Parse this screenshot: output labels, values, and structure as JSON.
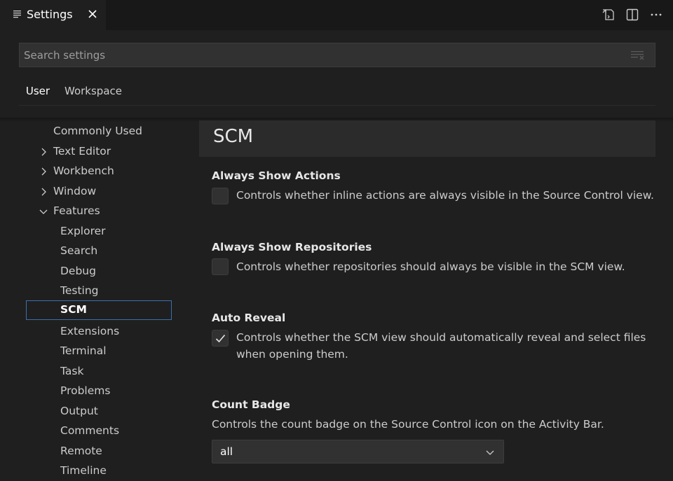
{
  "tab": {
    "title": "Settings"
  },
  "search": {
    "placeholder": "Search settings"
  },
  "scope_tabs": {
    "user": "User",
    "workspace": "Workspace"
  },
  "toc": {
    "commonly_used": "Commonly Used",
    "text_editor": "Text Editor",
    "workbench": "Workbench",
    "window": "Window",
    "features": "Features",
    "explorer": "Explorer",
    "search": "Search",
    "debug": "Debug",
    "testing": "Testing",
    "scm": "SCM",
    "extensions": "Extensions",
    "terminal": "Terminal",
    "task": "Task",
    "problems": "Problems",
    "output": "Output",
    "comments": "Comments",
    "remote": "Remote",
    "timeline": "Timeline"
  },
  "section": {
    "title": "SCM"
  },
  "settings": {
    "always_show_actions": {
      "title": "Always Show Actions",
      "description": "Controls whether inline actions are always visible in the Source Control view.",
      "checked": false
    },
    "always_show_repositories": {
      "title": "Always Show Repositories",
      "description": "Controls whether repositories should always be visible in the SCM view.",
      "checked": false
    },
    "auto_reveal": {
      "title": "Auto Reveal",
      "description_line1": "Controls whether the SCM view should automatically reveal and select files",
      "description_line2": "when opening them.",
      "checked": true
    },
    "count_badge": {
      "title": "Count Badge",
      "description": "Controls the count badge on the Source Control icon on the Activity Bar.",
      "value": "all"
    }
  },
  "icons": {
    "tab": "list-settings-icon",
    "close": "close-icon",
    "open_json": "open-settings-json-icon",
    "split": "split-editor-icon",
    "more": "more-actions-icon",
    "clear_filter": "clear-filter-icon",
    "chevron_right": "chevron-right-icon",
    "chevron_down": "chevron-down-icon",
    "check": "check-icon"
  },
  "colors": {
    "background": "#1f1f1f",
    "tabbar": "#181818",
    "section_header": "#2b2b2b",
    "focus_border": "#3a6fb0",
    "input": "#313131"
  }
}
